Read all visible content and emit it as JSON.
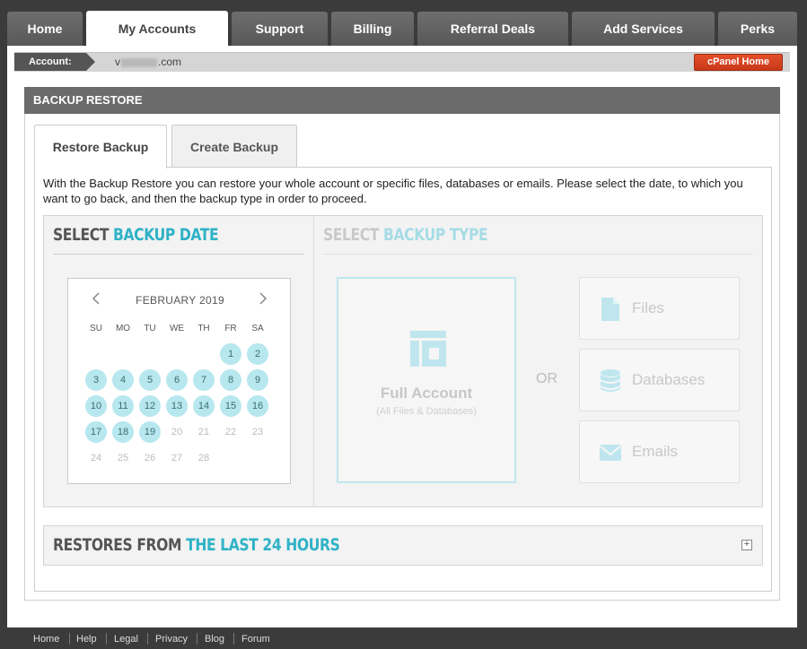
{
  "nav": {
    "tabs": [
      {
        "label": "Home"
      },
      {
        "label": "My Accounts",
        "active": true
      },
      {
        "label": "Support"
      },
      {
        "label": "Billing"
      },
      {
        "label": "Referral Deals"
      },
      {
        "label": "Add Services"
      },
      {
        "label": "Perks"
      }
    ]
  },
  "account": {
    "label": "Account:",
    "domain_prefix": "v",
    "domain_suffix": ".com",
    "cpanel_label": "cPanel Home"
  },
  "panel": {
    "title": "BACKUP RESTORE",
    "tabs": [
      {
        "label": "Restore Backup",
        "active": true
      },
      {
        "label": "Create Backup"
      }
    ],
    "description": "With the Backup Restore you can restore your whole account or specific files, databases or emails. Please select the date, to which you want to go back, and then the backup type in order to proceed."
  },
  "select_date": {
    "title_a": "SELECT ",
    "title_b": "BACKUP DATE"
  },
  "calendar": {
    "prev_icon": "chevron-left-icon",
    "next_icon": "chevron-right-icon",
    "month": "FEBRUARY 2019",
    "weekdays": [
      "SU",
      "MO",
      "TU",
      "WE",
      "TH",
      "FR",
      "SA"
    ],
    "days": [
      {
        "d": "1",
        "available": true
      },
      {
        "d": "2",
        "available": true
      },
      {
        "d": "3",
        "available": true
      },
      {
        "d": "4",
        "available": true
      },
      {
        "d": "5",
        "available": true
      },
      {
        "d": "6",
        "available": true
      },
      {
        "d": "7",
        "available": true
      },
      {
        "d": "8",
        "available": true
      },
      {
        "d": "9",
        "available": true
      },
      {
        "d": "10",
        "available": true
      },
      {
        "d": "11",
        "available": true
      },
      {
        "d": "12",
        "available": true
      },
      {
        "d": "13",
        "available": true
      },
      {
        "d": "14",
        "available": true
      },
      {
        "d": "15",
        "available": true
      },
      {
        "d": "16",
        "available": true
      },
      {
        "d": "17",
        "available": true
      },
      {
        "d": "18",
        "available": true
      },
      {
        "d": "19",
        "available": true
      },
      {
        "d": "20",
        "available": false
      },
      {
        "d": "21",
        "available": false
      },
      {
        "d": "22",
        "available": false
      },
      {
        "d": "23",
        "available": false
      },
      {
        "d": "24",
        "available": false
      },
      {
        "d": "25",
        "available": false
      },
      {
        "d": "26",
        "available": false
      },
      {
        "d": "27",
        "available": false
      },
      {
        "d": "28",
        "available": false
      }
    ],
    "first_weekday": 5
  },
  "select_type": {
    "title_a": "SELECT ",
    "title_b": "BACKUP TYPE",
    "full_account": {
      "title": "Full Account",
      "subtitle": "(All Files & Databases)",
      "icon": "layout-icon"
    },
    "or_label": "OR",
    "options": [
      {
        "label": "Files",
        "icon": "file-icon"
      },
      {
        "label": "Databases",
        "icon": "database-icon"
      },
      {
        "label": "Emails",
        "icon": "envelope-icon"
      }
    ]
  },
  "restores": {
    "title_a": "RESTORES FROM ",
    "title_b": "THE LAST 24 HOURS",
    "toggle_icon": "plus-icon"
  },
  "footer": {
    "links": [
      "Home",
      "Help",
      "Legal",
      "Privacy",
      "Blog",
      "Forum"
    ]
  },
  "colors": {
    "accent": "#2eb2c6",
    "available_day": "#b7e7ef",
    "cpanel_button": "#d9441f",
    "header_bar": "#6b6b6b"
  }
}
